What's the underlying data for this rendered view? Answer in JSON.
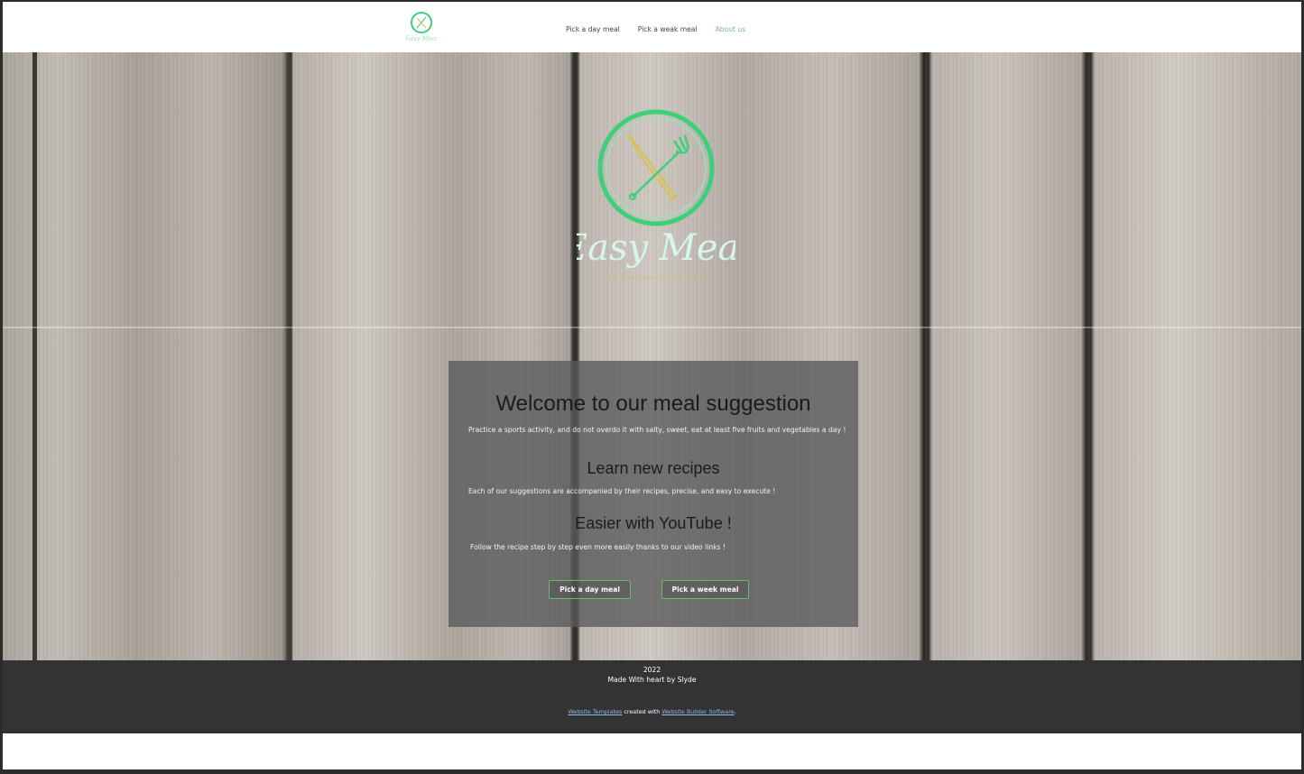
{
  "brand": {
    "logo_text": "Easy Meal",
    "accent_color": "#3ecf7a",
    "secondary_color": "#d9c24a"
  },
  "nav": {
    "items": [
      {
        "label": "Pick a day meal",
        "active": false
      },
      {
        "label": "Pick a weak meal",
        "active": false
      },
      {
        "label": "About us",
        "active": true
      }
    ]
  },
  "main": {
    "title": "Welcome to our meal suggestion",
    "intro": "Practice a sports activity, and do not overdo it with salty, sweet, eat at least five fruits and vegetables a day !",
    "section1_title": "Learn new recipes",
    "section1_text": "Each of our suggestions are accompanied by their recipes, precise, and easy to execute !",
    "section2_title": "Easier with YouTube !",
    "section2_text": "Follow the recipe step by step even more easily thanks to our video links !",
    "btn_day": "Pick a day meal",
    "btn_week": "Pick a week meal"
  },
  "footer": {
    "year": "2022",
    "made_by": "Made With heart by Slyde",
    "link1": "Website Templates",
    "mid": " created with ",
    "link2": "Website Builder Software",
    "end": "."
  }
}
